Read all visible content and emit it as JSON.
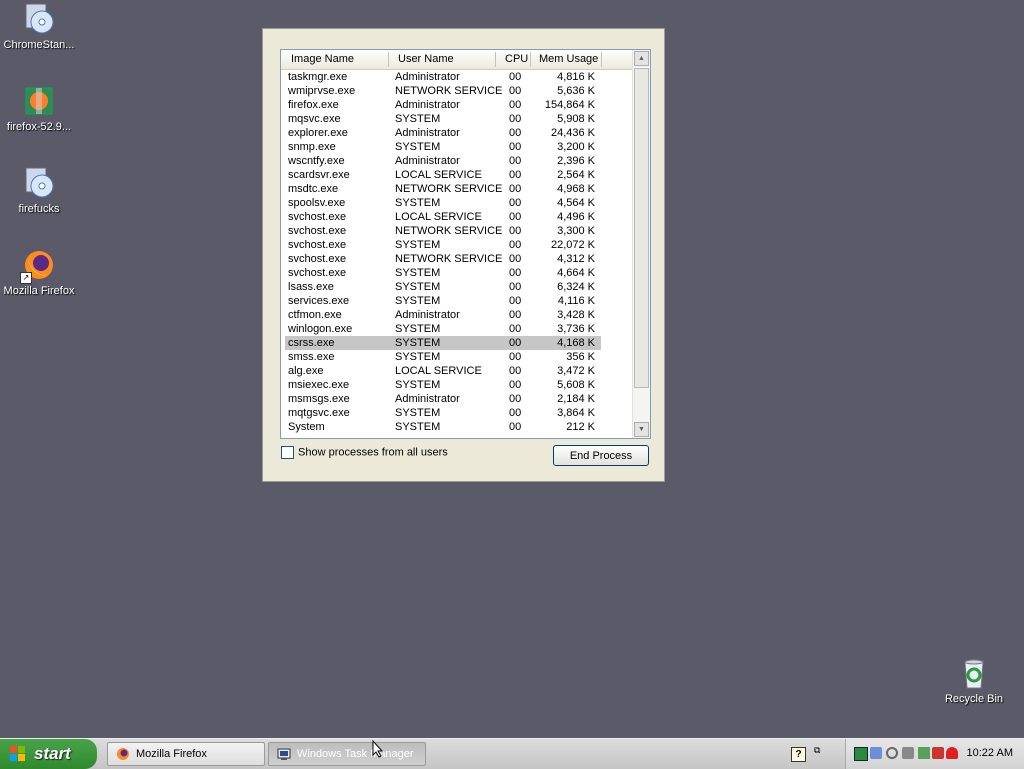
{
  "desktop": {
    "icons": [
      {
        "label": "ChromeStan..."
      },
      {
        "label": "firefox-52.9..."
      },
      {
        "label": "firefucks"
      },
      {
        "label": "Mozilla Firefox"
      },
      {
        "label": "Recycle Bin"
      }
    ]
  },
  "task_manager": {
    "columns": [
      "Image Name",
      "User Name",
      "CPU",
      "Mem Usage"
    ],
    "processes": [
      {
        "name": "taskmgr.exe",
        "user": "Administrator",
        "cpu": "00",
        "mem": "4,816 K"
      },
      {
        "name": "wmiprvse.exe",
        "user": "NETWORK SERVICE",
        "cpu": "00",
        "mem": "5,636 K"
      },
      {
        "name": "firefox.exe",
        "user": "Administrator",
        "cpu": "00",
        "mem": "154,864 K"
      },
      {
        "name": "mqsvc.exe",
        "user": "SYSTEM",
        "cpu": "00",
        "mem": "5,908 K"
      },
      {
        "name": "explorer.exe",
        "user": "Administrator",
        "cpu": "00",
        "mem": "24,436 K"
      },
      {
        "name": "snmp.exe",
        "user": "SYSTEM",
        "cpu": "00",
        "mem": "3,200 K"
      },
      {
        "name": "wscntfy.exe",
        "user": "Administrator",
        "cpu": "00",
        "mem": "2,396 K"
      },
      {
        "name": "scardsvr.exe",
        "user": "LOCAL SERVICE",
        "cpu": "00",
        "mem": "2,564 K"
      },
      {
        "name": "msdtc.exe",
        "user": "NETWORK SERVICE",
        "cpu": "00",
        "mem": "4,968 K"
      },
      {
        "name": "spoolsv.exe",
        "user": "SYSTEM",
        "cpu": "00",
        "mem": "4,564 K"
      },
      {
        "name": "svchost.exe",
        "user": "LOCAL SERVICE",
        "cpu": "00",
        "mem": "4,496 K"
      },
      {
        "name": "svchost.exe",
        "user": "NETWORK SERVICE",
        "cpu": "00",
        "mem": "3,300 K"
      },
      {
        "name": "svchost.exe",
        "user": "SYSTEM",
        "cpu": "00",
        "mem": "22,072 K"
      },
      {
        "name": "svchost.exe",
        "user": "NETWORK SERVICE",
        "cpu": "00",
        "mem": "4,312 K"
      },
      {
        "name": "svchost.exe",
        "user": "SYSTEM",
        "cpu": "00",
        "mem": "4,664 K"
      },
      {
        "name": "lsass.exe",
        "user": "SYSTEM",
        "cpu": "00",
        "mem": "6,324 K"
      },
      {
        "name": "services.exe",
        "user": "SYSTEM",
        "cpu": "00",
        "mem": "4,116 K"
      },
      {
        "name": "ctfmon.exe",
        "user": "Administrator",
        "cpu": "00",
        "mem": "3,428 K"
      },
      {
        "name": "winlogon.exe",
        "user": "SYSTEM",
        "cpu": "00",
        "mem": "3,736 K"
      },
      {
        "name": "csrss.exe",
        "user": "SYSTEM",
        "cpu": "00",
        "mem": "4,168 K",
        "selected": true
      },
      {
        "name": "smss.exe",
        "user": "SYSTEM",
        "cpu": "00",
        "mem": "356 K"
      },
      {
        "name": "alg.exe",
        "user": "LOCAL SERVICE",
        "cpu": "00",
        "mem": "3,472 K"
      },
      {
        "name": "msiexec.exe",
        "user": "SYSTEM",
        "cpu": "00",
        "mem": "5,608 K"
      },
      {
        "name": "msmsgs.exe",
        "user": "Administrator",
        "cpu": "00",
        "mem": "2,184 K"
      },
      {
        "name": "mqtgsvc.exe",
        "user": "SYSTEM",
        "cpu": "00",
        "mem": "3,864 K"
      },
      {
        "name": "System",
        "user": "SYSTEM",
        "cpu": "00",
        "mem": "212 K"
      }
    ],
    "show_all_label": "Show processes from all users",
    "show_all_checked": false,
    "end_process_label": "End Process"
  },
  "taskbar": {
    "start_label": "start",
    "tasks": [
      {
        "label": "Mozilla Firefox",
        "icon": "firefox-icon"
      },
      {
        "label": "Windows Task Manager",
        "icon": "task-manager-icon"
      }
    ],
    "clock": "10:22 AM"
  }
}
